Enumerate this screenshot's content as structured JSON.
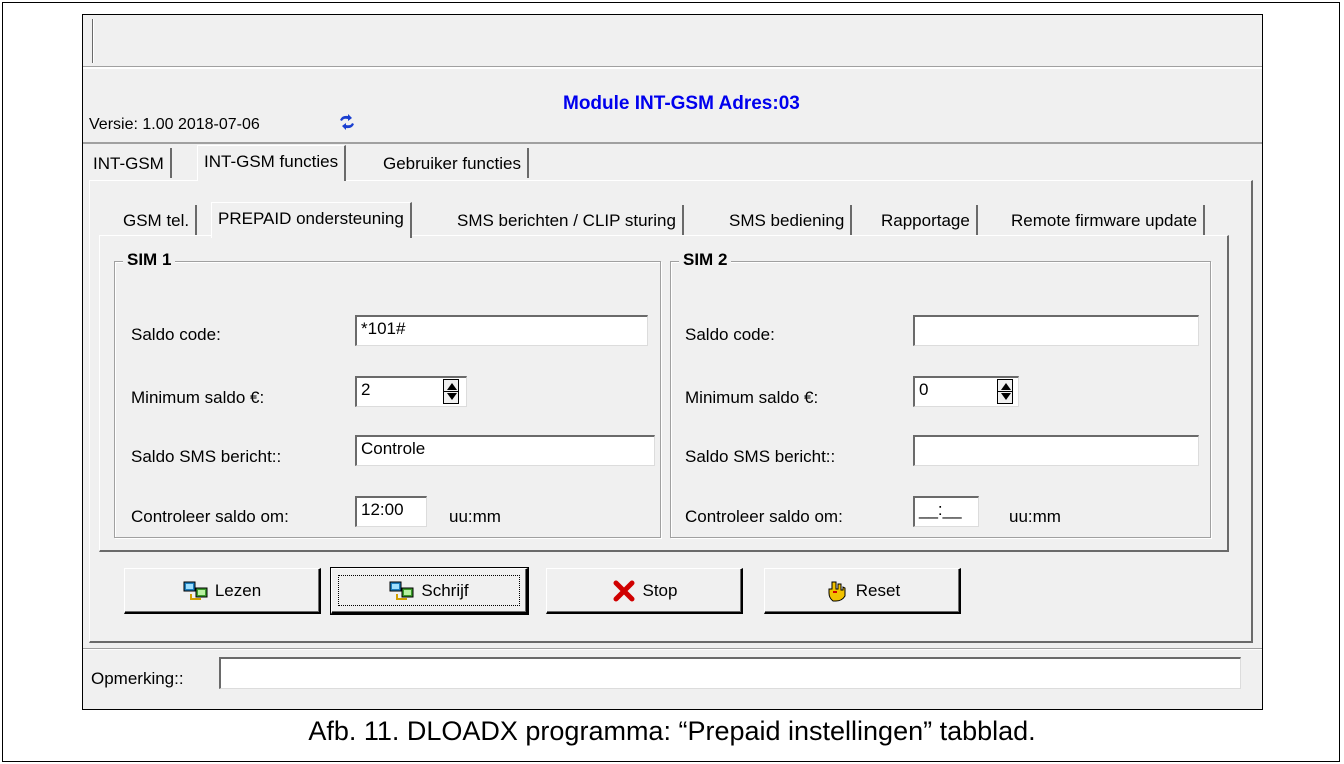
{
  "header": {
    "module_title": "Module INT-GSM Adres:03",
    "version": "Versie: 1.00 2018-07-06"
  },
  "main_tabs": [
    "INT-GSM",
    "INT-GSM functies",
    "Gebruiker functies"
  ],
  "main_active_tab": "INT-GSM functies",
  "sub_tabs": [
    "GSM tel.",
    "PREPAID ondersteuning",
    "SMS berichten / CLIP sturing",
    "SMS bediening",
    "Rapportage",
    "Remote firmware update"
  ],
  "sub_active_tab": "PREPAID ondersteuning",
  "sim1": {
    "title": "SIM 1",
    "saldo_code_label": "Saldo code:",
    "saldo_code_value": "*101#",
    "min_saldo_label": "Minimum saldo €:",
    "min_saldo_value": "2",
    "sms_label": "Saldo SMS bericht::",
    "sms_value": "Controle",
    "check_label": "Controleer saldo om:",
    "check_value": "12:00",
    "check_unit": "uu:mm"
  },
  "sim2": {
    "title": "SIM 2",
    "saldo_code_label": "Saldo code:",
    "saldo_code_value": "",
    "min_saldo_label": "Minimum saldo €:",
    "min_saldo_value": "0",
    "sms_label": "Saldo SMS bericht::",
    "sms_value": "",
    "check_label": "Controleer saldo om:",
    "check_value": "__:__",
    "check_unit": "uu:mm"
  },
  "buttons": {
    "read": "Lezen",
    "write": "Schrijf",
    "stop": "Stop",
    "reset": "Reset"
  },
  "icons": {
    "read": "computer-transfer-icon",
    "write": "computer-transfer-icon",
    "stop": "red-x-icon",
    "reset": "yellow-hand-icon",
    "version": "sync-icon"
  },
  "remark": {
    "label": "Opmerking::",
    "value": ""
  },
  "caption": "Afb. 11. DLOADX programma: “Prepaid instellingen” tabblad.",
  "colors": {
    "title_blue": "#0000ee",
    "window_bg": "#f0f0f0",
    "stop_red": "#d00000",
    "reset_yellow": "#f2c200"
  }
}
